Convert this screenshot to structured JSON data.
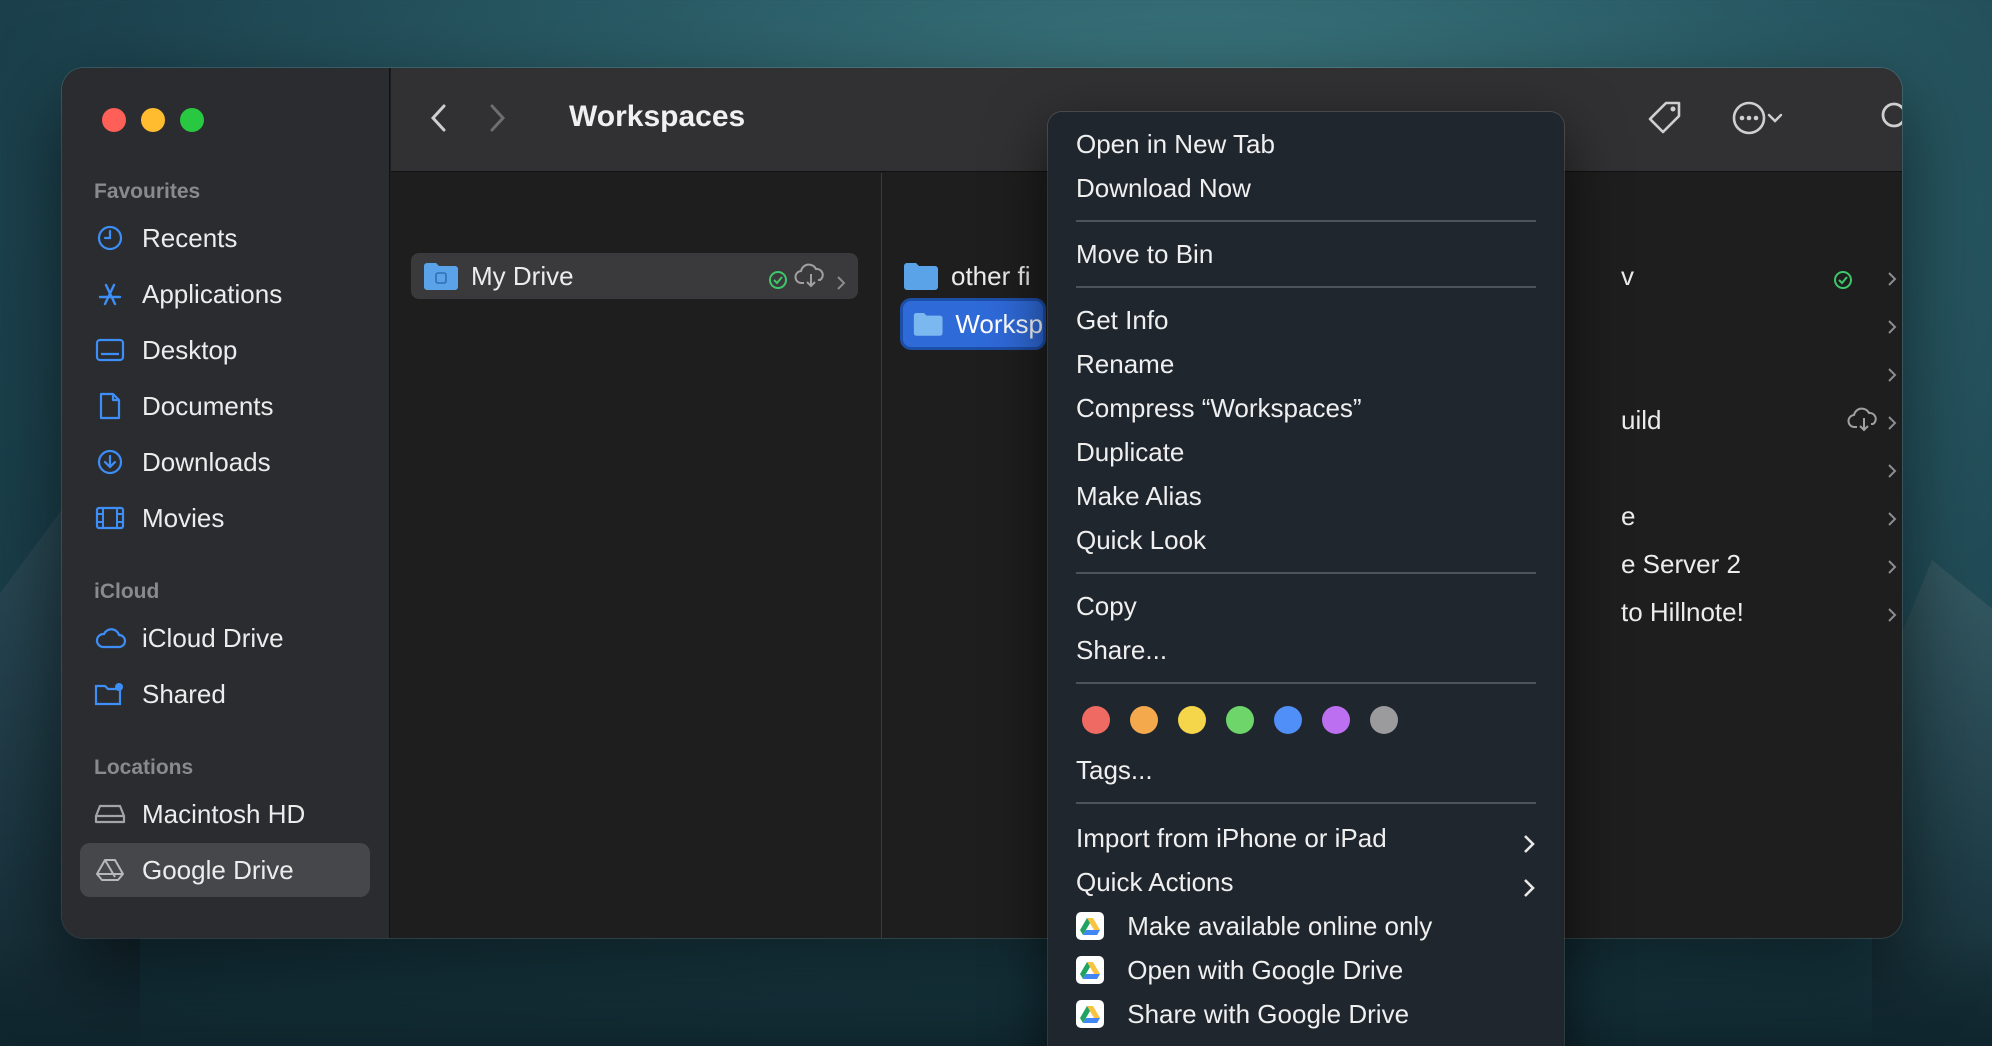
{
  "window": {
    "title": "Workspaces"
  },
  "sidebar": {
    "sections": [
      {
        "label": "Favourites",
        "items": [
          {
            "label": "Recents",
            "icon": "clock-icon"
          },
          {
            "label": "Applications",
            "icon": "applications-icon"
          },
          {
            "label": "Desktop",
            "icon": "desktop-icon"
          },
          {
            "label": "Documents",
            "icon": "document-icon"
          },
          {
            "label": "Downloads",
            "icon": "download-icon"
          },
          {
            "label": "Movies",
            "icon": "film-icon"
          }
        ]
      },
      {
        "label": "iCloud",
        "items": [
          {
            "label": "iCloud Drive",
            "icon": "cloud-icon"
          },
          {
            "label": "Shared",
            "icon": "shared-folder-icon"
          }
        ]
      },
      {
        "label": "Locations",
        "items": [
          {
            "label": "Macintosh HD",
            "icon": "harddrive-icon"
          },
          {
            "label": "Google Drive",
            "icon": "google-drive-icon",
            "selected": true
          }
        ]
      }
    ]
  },
  "columns": {
    "col1": [
      {
        "label": "My Drive",
        "status": "synced",
        "cloud": true
      }
    ],
    "col2": [
      {
        "label": "other fi"
      },
      {
        "label": "Worksp",
        "selected": true
      }
    ],
    "col3": [
      {
        "label": "v",
        "synced": true
      },
      {
        "label": ""
      },
      {
        "label": ""
      },
      {
        "label": "uild",
        "cloud": true
      },
      {
        "label": ""
      },
      {
        "label": "e"
      },
      {
        "label": "e Server 2"
      },
      {
        "label": "to Hillnote!"
      }
    ]
  },
  "context_menu": {
    "open_new_tab": "Open in New Tab",
    "download_now": "Download Now",
    "move_to_bin": "Move to Bin",
    "get_info": "Get Info",
    "rename": "Rename",
    "compress": "Compress “Workspaces”",
    "duplicate": "Duplicate",
    "make_alias": "Make Alias",
    "quick_look": "Quick Look",
    "copy": "Copy",
    "share": "Share...",
    "tags": "Tags...",
    "import_from": "Import from iPhone or iPad",
    "quick_actions": "Quick Actions",
    "make_online_only": "Make available online only",
    "open_with_gdrive": "Open with Google Drive",
    "share_with_gdrive": "Share with Google Drive",
    "tag_colors": [
      "#ee6a63",
      "#f4a94c",
      "#f5d54a",
      "#6dd56a",
      "#4f8ff7",
      "#bc6ff0",
      "#9b9b9e"
    ]
  },
  "colors": {
    "accent": "#2f6ad9",
    "sidebar_icon": "#3d8ef7"
  }
}
